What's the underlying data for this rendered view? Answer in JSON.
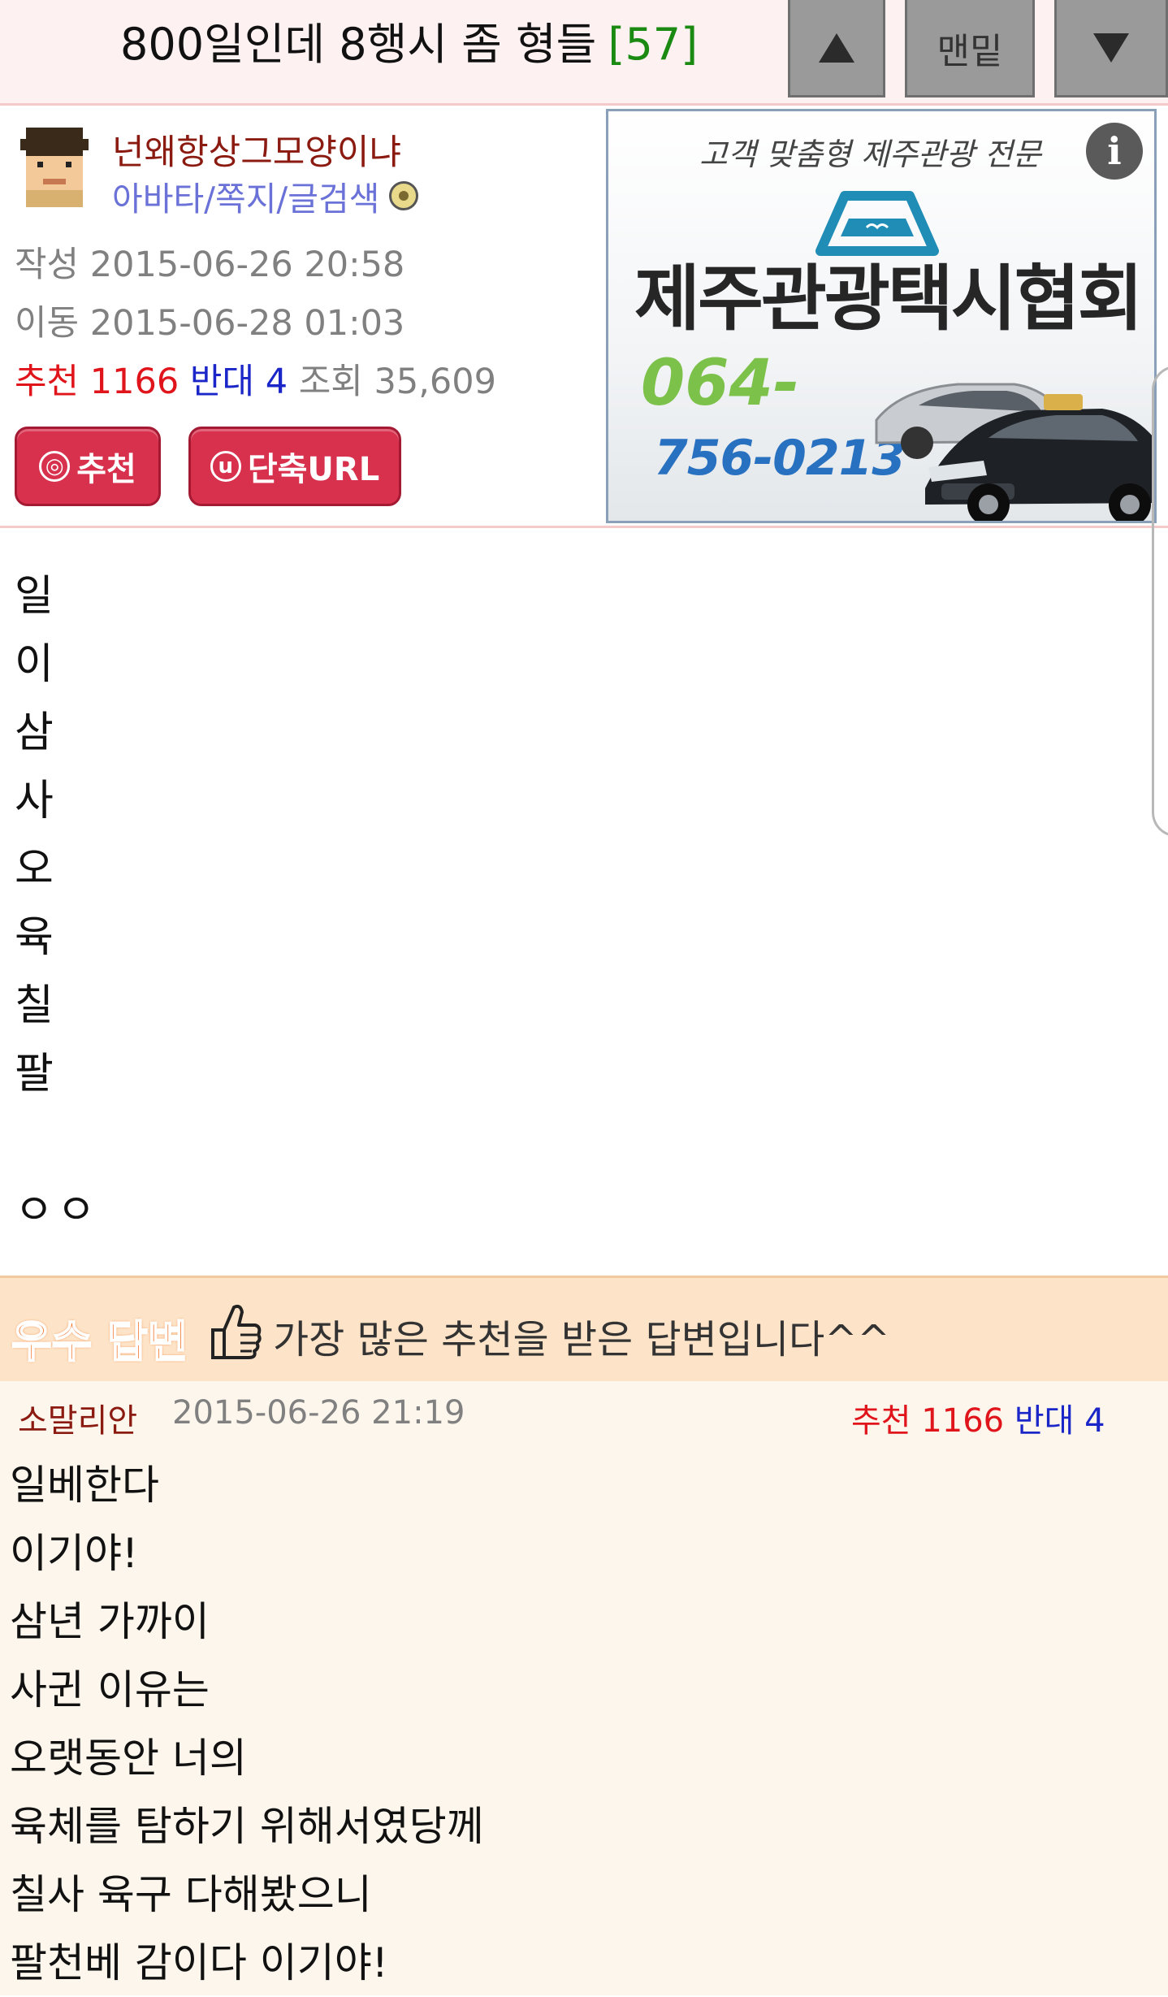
{
  "header": {
    "title": "800일인데 8행시 좀 형들",
    "comment_count": "[57]",
    "bottom_button_label": "맨밑"
  },
  "author": {
    "nickname": "넌왜항상그모양이냐",
    "links": "아바타/쪽지/글검색",
    "written_label": "작성",
    "written": "2015-06-26 20:58",
    "moved_label": "이동",
    "moved": "2015-06-28 01:03",
    "recommend_label": "추천",
    "recommend_count": "1166",
    "oppose_label": "반대",
    "oppose_count": "4",
    "views_label": "조회",
    "views_count": "35,609"
  },
  "buttons": {
    "recommend_icon": "◎",
    "recommend": "추천",
    "short_url_icon": "u",
    "short_url": "단축URL"
  },
  "ad": {
    "tagline": "고객 맞춤형 제주관광 전문",
    "info": "i",
    "name": "제주관광택시협회",
    "phone_prefix": "064-",
    "phone_number": "756-0213"
  },
  "post": {
    "lines": [
      "일",
      "이",
      "삼",
      "사",
      "오",
      "육",
      "칠",
      "팔"
    ],
    "closing": "ㅇㅇ"
  },
  "best": {
    "badge": "우수 답변",
    "description": "가장 많은 추천을 받은 답변입니다^^",
    "author": "소말리안",
    "date": "2015-06-26 21:19",
    "recommend_label": "추천",
    "recommend_count": "1166",
    "oppose_label": "반대",
    "oppose_count": "4",
    "lines": [
      "일베한다",
      "이기야!",
      "삼년 가까이",
      "사귄 이유는",
      "오랫동안 너의",
      "육체를 탐하기 위해서였당께",
      "칠사 육구 다해봤으니",
      "팔천베 감이다 이기야!"
    ]
  },
  "colors": {
    "header_bg": "#fdf1f1",
    "recommend": "#e0151b",
    "oppose": "#1b26c9",
    "button": "#d8314e",
    "best_head_bg": "#fde4c8",
    "reply_bg": "#fdf6ec",
    "comment_count": "#1a8a12"
  },
  "icons": {
    "up": "triangle-up-icon",
    "down": "triangle-down-icon",
    "medal": "medal-icon",
    "thumbs_up": "thumbs-up-icon",
    "info": "info-icon"
  }
}
